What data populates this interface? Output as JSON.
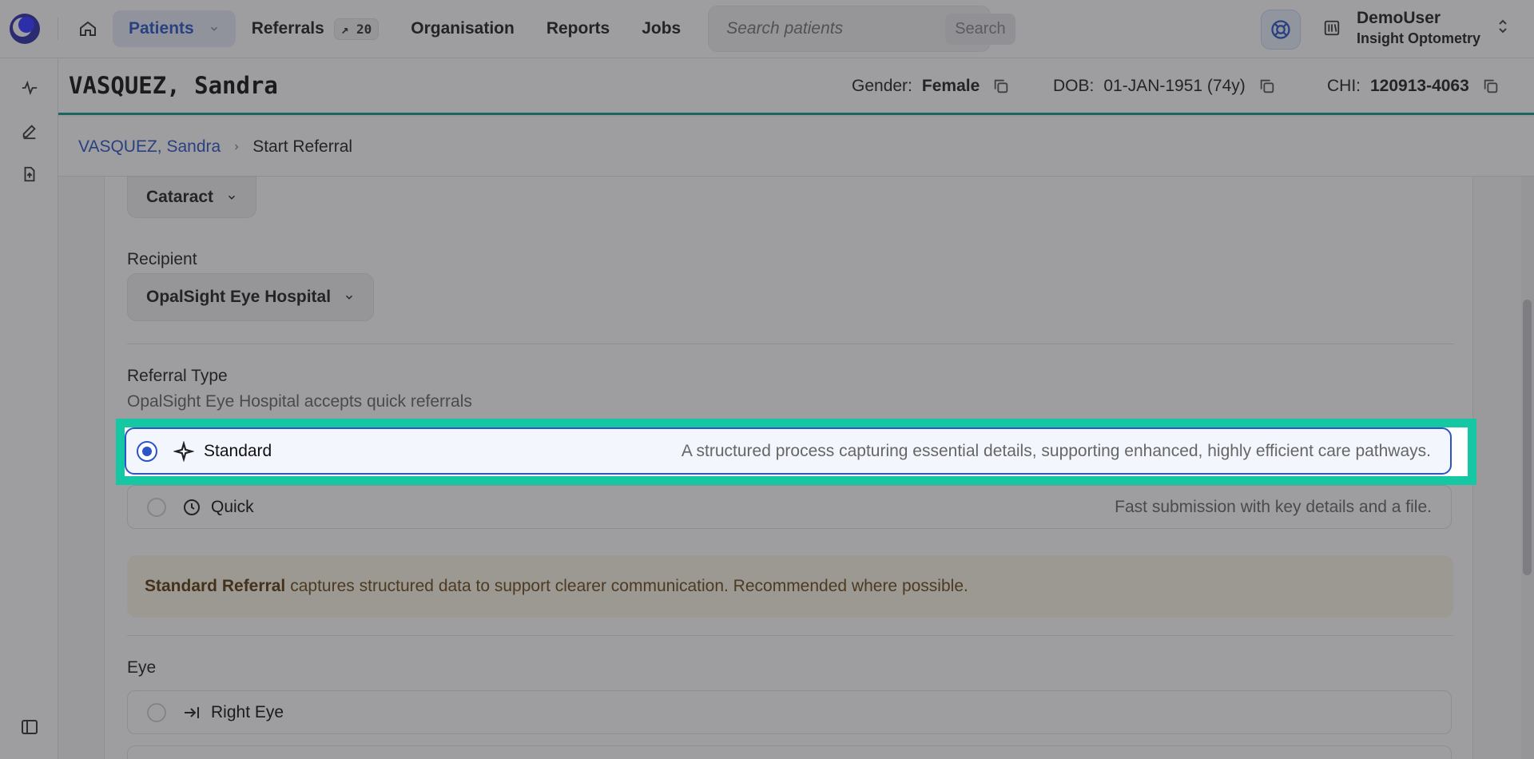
{
  "nav": {
    "patients_label": "Patients",
    "referrals_label": "Referrals",
    "referrals_badge": "↗ 20",
    "organisation_label": "Organisation",
    "reports_label": "Reports",
    "jobs_label": "Jobs",
    "search_placeholder": "Search patients",
    "search_button": "Search"
  },
  "user": {
    "name": "DemoUser",
    "org": "Insight Optometry"
  },
  "patient": {
    "name": "VASQUEZ, Sandra",
    "gender_label": "Gender:",
    "gender": "Female",
    "dob_label": "DOB:",
    "dob": "01-JAN-1951 (74y)",
    "chi_label": "CHI:",
    "chi": "120913-4063"
  },
  "breadcrumb": {
    "patient": "VASQUEZ, Sandra",
    "current": "Start Referral"
  },
  "form": {
    "condition_value": "Cataract",
    "recipient_label": "Recipient",
    "recipient_value": "OpalSight Eye Hospital",
    "referral_type_label": "Referral Type",
    "referral_type_sub": "OpalSight Eye Hospital accepts quick referrals",
    "options": [
      {
        "title": "Standard",
        "desc": "A structured process capturing essential details, supporting enhanced, highly efficient care pathways.",
        "selected": true,
        "icon": "sparkle-icon"
      },
      {
        "title": "Quick",
        "desc": "Fast submission with key details and a file.",
        "selected": false,
        "icon": "clock-icon"
      }
    ],
    "notice_bold": "Standard Referral",
    "notice_text": "captures structured data to support clearer communication. Recommended where possible.",
    "eye_label": "Eye",
    "eye_options": [
      {
        "title": "Right Eye",
        "icon": "arrow-to-right-icon"
      }
    ]
  },
  "colors": {
    "accent": "#2b55c6",
    "teal": "#0f9b87",
    "highlight": "#16c7a4"
  }
}
